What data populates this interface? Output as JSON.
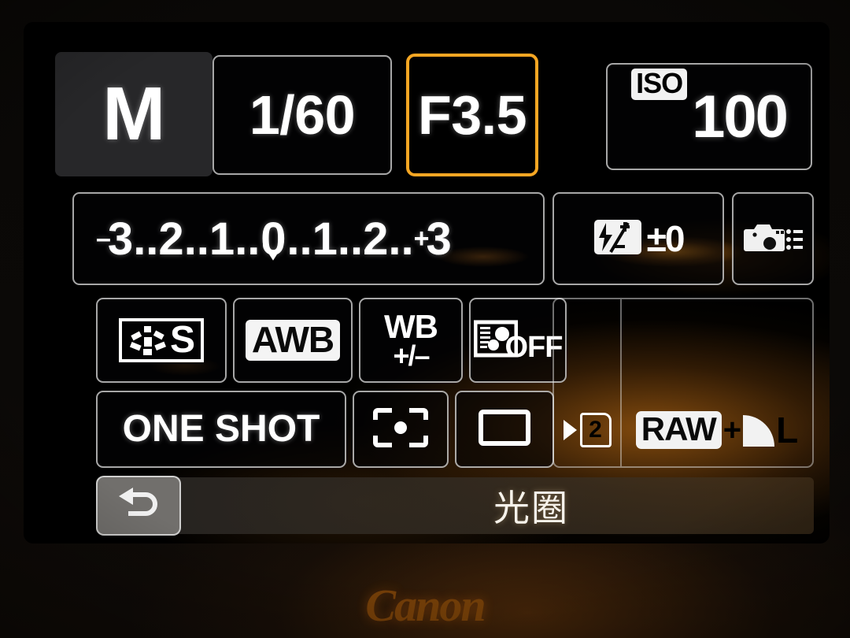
{
  "device": {
    "brand": "Canon",
    "screen_name": "Quick Control Screen"
  },
  "exposure": {
    "mode_label": "M",
    "shutter_speed": "1/60",
    "aperture": "F3.5",
    "iso_label": "ISO",
    "iso_value": "100",
    "selected_field": "aperture",
    "selection_color": "#f5a623"
  },
  "exposure_compensation": {
    "minus_sign": "–",
    "scale_text": "3..2..1..0..1..2..3",
    "plus_sign": "+",
    "left_values": [
      "3",
      "2",
      "1"
    ],
    "center_value": "0",
    "right_values": [
      "1",
      "2",
      "3"
    ],
    "indicator_position": "0",
    "dots": ".."
  },
  "flash_compensation": {
    "icon": "flash-exposure-compensation-icon",
    "value": "±0"
  },
  "custom_controls": {
    "icon": "camera-custom-settings-icon"
  },
  "picture_style": {
    "icon": "picture-style-icon",
    "value": "S"
  },
  "white_balance": {
    "value": "AWB"
  },
  "wb_shift": {
    "top": "WB",
    "bottom": "+/–"
  },
  "auto_lighting_optimizer": {
    "icon": "auto-lighting-optimizer-icon",
    "value": "OFF"
  },
  "af_mode": {
    "value": "ONE SHOT"
  },
  "metering": {
    "icon": "evaluative-metering-icon"
  },
  "drive_mode": {
    "icon": "single-shooting-icon"
  },
  "record_card": {
    "arrow": "record-arrow-icon",
    "slot": "2"
  },
  "image_quality": {
    "raw_label": "RAW",
    "plus": "+",
    "jpeg_size": "L"
  },
  "bottom_bar": {
    "return_icon": "return-arrow-icon",
    "hint_label": "光圈"
  },
  "colors": {
    "selection": "#f5a623",
    "screen_background": "#000000",
    "tile_border": "#e8e8e8",
    "text": "#ffffff",
    "logo": "#7a4209"
  }
}
